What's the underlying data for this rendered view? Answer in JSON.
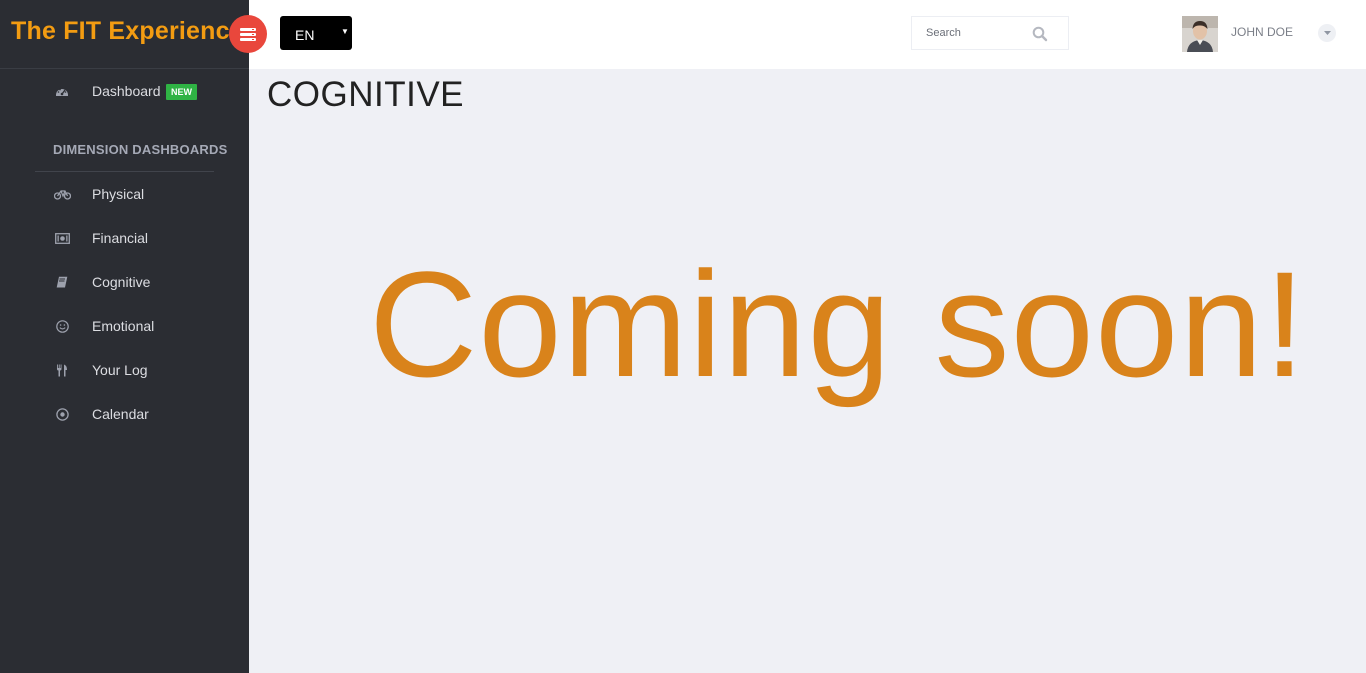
{
  "brand": {
    "title": "The FIT Experience"
  },
  "sidebar": {
    "dashboard": {
      "label": "Dashboard",
      "badge": "NEW",
      "icon": "dashboard-gauge-icon"
    },
    "section_title": "DIMENSION DASHBOARDS",
    "items": [
      {
        "label": "Physical",
        "icon": "bicycle-icon"
      },
      {
        "label": "Financial",
        "icon": "money-icon"
      },
      {
        "label": "Cognitive",
        "icon": "book-icon"
      },
      {
        "label": "Emotional",
        "icon": "smile-icon"
      },
      {
        "label": "Your Log",
        "icon": "cutlery-icon"
      },
      {
        "label": "Calendar",
        "icon": "circle-dot-icon"
      }
    ]
  },
  "header": {
    "language": "EN",
    "search": {
      "placeholder": "Search"
    },
    "user": {
      "name": "JOHN DOE"
    }
  },
  "main": {
    "page_title": "COGNITIVE",
    "message": "Coming soon!"
  },
  "colors": {
    "sidebar_bg": "#2b2d33",
    "brand": "#f39c12",
    "toggle": "#e9473c",
    "badge": "#2fb344",
    "message": "#d9831b",
    "content_bg": "#eff0f5"
  }
}
